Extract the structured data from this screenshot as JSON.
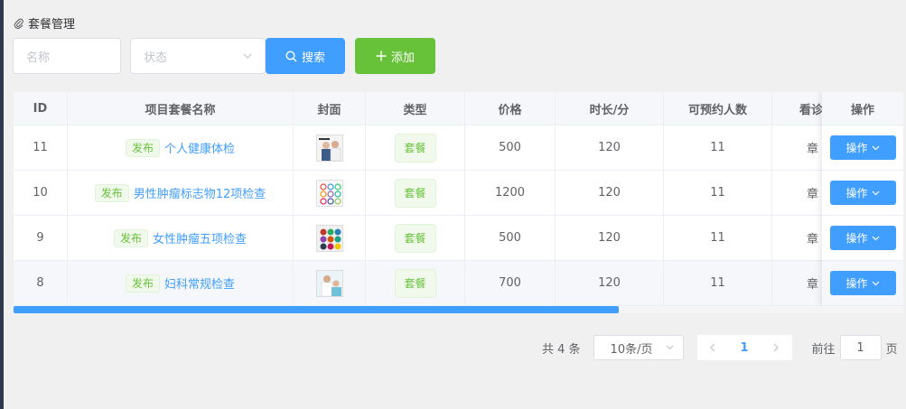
{
  "breadcrumb": {
    "title": "套餐管理",
    "icon": "paperclip-icon"
  },
  "filters": {
    "name_placeholder": "名称",
    "status_placeholder": "状态",
    "search_label": "搜索",
    "add_label": "添加"
  },
  "table": {
    "columns": [
      "ID",
      "项目套餐名称",
      "封面",
      "类型",
      "价格",
      "时长/分",
      "可预约人数",
      "看诊",
      "操作"
    ],
    "rows": [
      {
        "id": "11",
        "status": "发布",
        "name": "个人健康体检",
        "type": "套餐",
        "price": "500",
        "duration": "120",
        "capacity": "11",
        "doctor": "章",
        "action": "操作",
        "cover": "couple-photo"
      },
      {
        "id": "10",
        "status": "发布",
        "name": "男性肿瘤标志物12项检查",
        "type": "套餐",
        "price": "1200",
        "duration": "120",
        "capacity": "11",
        "doctor": "章",
        "action": "操作",
        "cover": "dot-grid-light"
      },
      {
        "id": "9",
        "status": "发布",
        "name": "女性肿瘤五项检查",
        "type": "套餐",
        "price": "500",
        "duration": "120",
        "capacity": "11",
        "doctor": "章",
        "action": "操作",
        "cover": "dot-grid-dark"
      },
      {
        "id": "8",
        "status": "发布",
        "name": "妇科常规检查",
        "type": "套餐",
        "price": "700",
        "duration": "120",
        "capacity": "11",
        "doctor": "章",
        "action": "操作",
        "cover": "doctor-photo"
      }
    ],
    "horizontal_scroll_fraction": 0.68
  },
  "pagination": {
    "total": "共 4 条",
    "page_size": "10条/页",
    "current_page": "1",
    "goto_label": "前往",
    "goto_value": "1",
    "page_suffix": "页"
  },
  "colors": {
    "primary": "#409eff",
    "success": "#67c23a"
  }
}
